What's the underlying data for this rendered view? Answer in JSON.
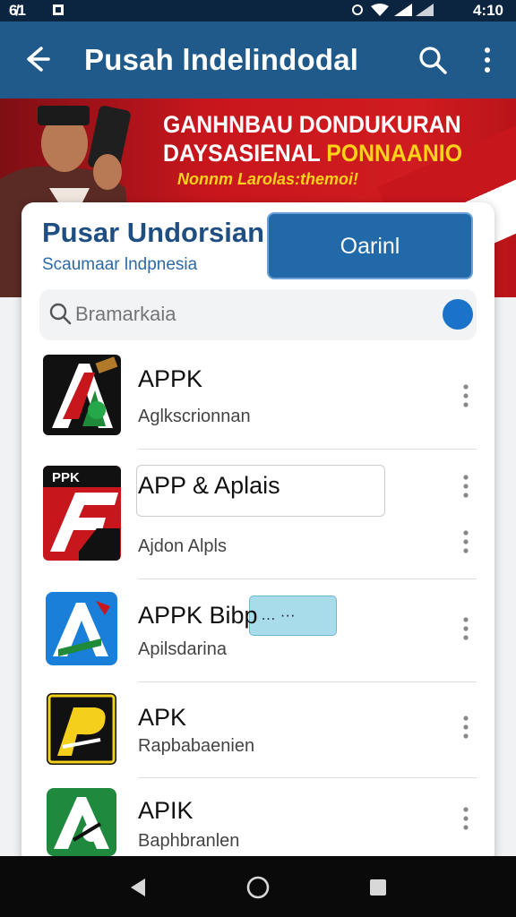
{
  "status_bar": {
    "left": "6̸1",
    "time": "4:10"
  },
  "app_bar": {
    "title": "Pusah lndelindodal"
  },
  "banner": {
    "line1": "GANHNBAU DONDUKURAN",
    "line2a": "DAYSASIENAL ",
    "line2b": "PONNAANIO",
    "line3": "Nonnm Larolas:themoi!"
  },
  "card": {
    "title": "Pusar Undorsian",
    "subtitle": "Scaumaar lndpnesia",
    "button": "Oarinl",
    "search_placeholder": "Bramarkaia"
  },
  "apps": [
    {
      "name": "APPK",
      "sub": "Aglkscrionnan",
      "icon_label": "A"
    },
    {
      "name": "APP & Aplais",
      "sub": "Ajdon Alpls",
      "icon_label": "PPK"
    },
    {
      "name": "APPK Bibp",
      "sub": "Apilsdarina",
      "icon_label": "A"
    },
    {
      "name": "APK",
      "sub": "Rapbabaenien",
      "icon_label": "P"
    },
    {
      "name": "APIK",
      "sub": "Baphbranlen",
      "icon_label": "A"
    }
  ],
  "pill": {
    "text": "… ···"
  },
  "colors": {
    "primary": "#1f5a8a",
    "banner_red": "#c8161d",
    "accent_yellow": "#ffd21a",
    "button_blue": "#2169a8"
  }
}
